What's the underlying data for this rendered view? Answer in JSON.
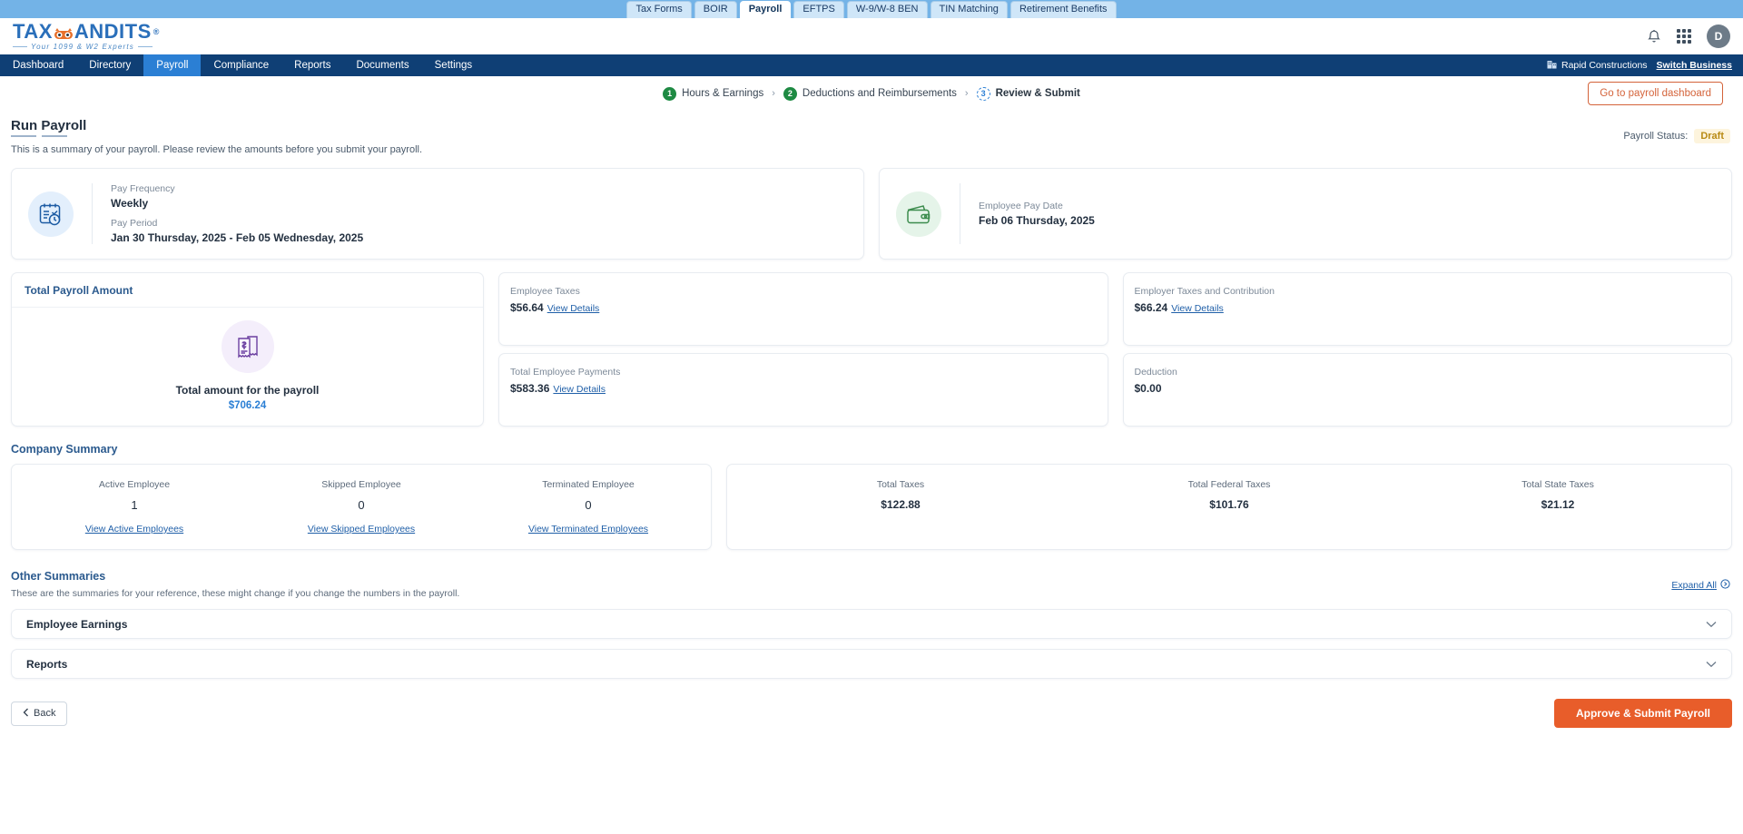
{
  "product_tabs": [
    {
      "label": "Tax Forms",
      "active": false
    },
    {
      "label": "BOIR",
      "active": false
    },
    {
      "label": "Payroll",
      "active": true
    },
    {
      "label": "EFTPS",
      "active": false
    },
    {
      "label": "W-9/W-8 BEN",
      "active": false
    },
    {
      "label": "TIN Matching",
      "active": false
    },
    {
      "label": "Retirement Benefits",
      "active": false
    }
  ],
  "brand": {
    "name_part1": "TAX",
    "name_part2": "ANDITS",
    "registered": "®",
    "tagline": "Your 1099 & W2 Experts"
  },
  "header": {
    "bell_icon": "bell-icon",
    "apps_icon": "apps-grid-icon",
    "avatar_initial": "D"
  },
  "nav": {
    "items": [
      {
        "label": "Dashboard",
        "active": false
      },
      {
        "label": "Directory",
        "active": false
      },
      {
        "label": "Payroll",
        "active": true
      },
      {
        "label": "Compliance",
        "active": false
      },
      {
        "label": "Reports",
        "active": false
      },
      {
        "label": "Documents",
        "active": false
      },
      {
        "label": "Settings",
        "active": false
      }
    ],
    "company_name": "Rapid Constructions",
    "switch_business": "Switch Business"
  },
  "stepper": {
    "steps": [
      {
        "num": "1",
        "label": "Hours & Earnings",
        "state": "done"
      },
      {
        "num": "2",
        "label": "Deductions and Reimbursements",
        "state": "done"
      },
      {
        "num": "3",
        "label": "Review & Submit",
        "state": "current"
      }
    ],
    "separator": "›",
    "dashboard_button": "Go to payroll dashboard"
  },
  "page": {
    "title": "Run Payroll",
    "subtitle": "This is a summary of your payroll. Please review the amounts before you submit your payroll.",
    "status_label": "Payroll Status:",
    "status_value": "Draft"
  },
  "pay_info": {
    "frequency_label": "Pay Frequency",
    "frequency_value": "Weekly",
    "period_label": "Pay Period",
    "period_value": "Jan 30 Thursday, 2025 - Feb 05 Wednesday, 2025",
    "paydate_label": "Employee Pay Date",
    "paydate_value": "Feb 06 Thursday, 2025",
    "calendar_icon": "calendar-clock-icon",
    "wallet_icon": "wallet-icon"
  },
  "total_payroll": {
    "card_title": "Total Payroll Amount",
    "receipt_icon": "receipt-dollar-icon",
    "caption": "Total amount for the payroll",
    "amount": "$706.24"
  },
  "mini_cards": [
    {
      "label": "Employee Taxes",
      "value": "$56.64",
      "link": "View Details"
    },
    {
      "label": "Employer Taxes and Contribution",
      "value": "$66.24",
      "link": "View Details"
    },
    {
      "label": "Total Employee Payments",
      "value": "$583.36",
      "link": "View Details"
    },
    {
      "label": "Deduction",
      "value": "$0.00",
      "link": ""
    }
  ],
  "company_summary": {
    "title": "Company Summary",
    "employees": [
      {
        "label": "Active Employee",
        "count": "1",
        "link": "View Active Employees"
      },
      {
        "label": "Skipped Employee",
        "count": "0",
        "link": "View Skipped Employees"
      },
      {
        "label": "Terminated Employee",
        "count": "0",
        "link": "View Terminated Employees"
      }
    ],
    "taxes": [
      {
        "label": "Total Taxes",
        "amount": "$122.88"
      },
      {
        "label": "Total Federal Taxes",
        "amount": "$101.76"
      },
      {
        "label": "Total State Taxes",
        "amount": "$21.12"
      }
    ]
  },
  "other_summaries": {
    "title": "Other Summaries",
    "description": "These are the summaries for your reference, these might change if you change the numbers in the payroll.",
    "expand_all": "Expand All",
    "expand_icon": "expand-circle-icon",
    "accordions": [
      {
        "label": "Employee Earnings",
        "icon": "chevron-down-icon"
      },
      {
        "label": "Reports",
        "icon": "chevron-down-icon"
      }
    ]
  },
  "footer": {
    "back_label": "Back",
    "back_icon": "chevron-left-icon",
    "submit_label": "Approve & Submit Payroll"
  },
  "colors": {
    "brand_blue": "#2a6fba",
    "nav_dark": "#0f3f75",
    "nav_active": "#2b7fd4",
    "accent_orange": "#e85d2a",
    "step_green": "#1e8a43",
    "status_amber": "#b88a14",
    "link_blue": "#1f5fa8"
  }
}
